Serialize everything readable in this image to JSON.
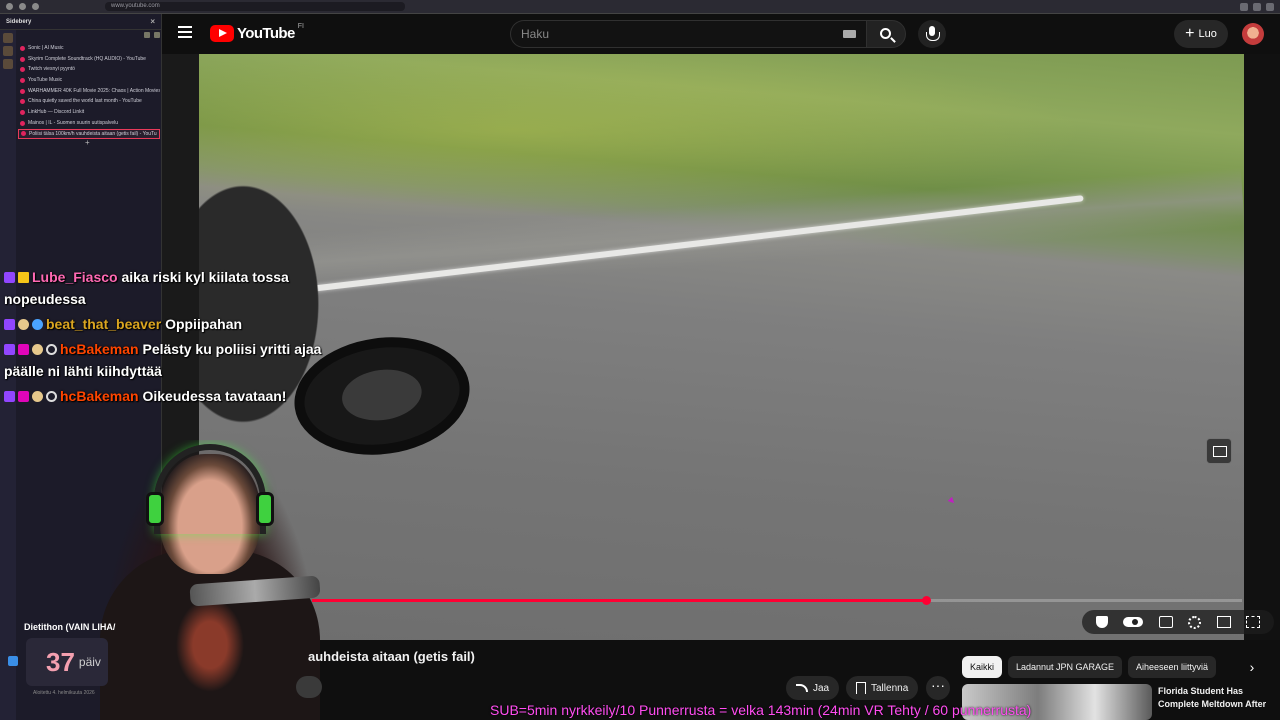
{
  "browser": {
    "url": "www.youtube.com"
  },
  "sidebery": {
    "title": "Sidebery",
    "tabs": [
      {
        "label": "Sonic | AI Music",
        "active": false
      },
      {
        "label": "Skyrim Complete Soundtrack (HQ AUDIO) - YouTube",
        "active": false
      },
      {
        "label": "Twitch viesnyi pyyntö",
        "active": false
      },
      {
        "label": "YouTube Music",
        "active": false
      },
      {
        "label": "WARHAMMER 40K Full Movie 2025: Chaos | Action Movies",
        "active": false
      },
      {
        "label": "China quietly saved the world last month - YouTube",
        "active": false
      },
      {
        "label": "LinkHub — Discord Linkit",
        "active": false
      },
      {
        "label": "Mainos | IL - Suomen suurin uutispalvelu",
        "active": false
      },
      {
        "label": "Poliisi tälsa 100km/h vauhdeista aitaan (getis fail) - YouTu",
        "active": true
      }
    ],
    "add_label": "+"
  },
  "header": {
    "logo_text": "YouTube",
    "country": "FI",
    "search_placeholder": "Haku",
    "create_label": "Luo"
  },
  "video": {
    "progress_fraction": 0.66
  },
  "chat": [
    {
      "user": "Lube_Fiasco",
      "color": "pink",
      "text": "aika riski kyl kiilata tossa nopeudessa"
    },
    {
      "user": "beat_that_beaver",
      "color": "gold",
      "text": "Oppiipahan"
    },
    {
      "user": "hcBakeman",
      "color": "red",
      "text": "Pelästy ku poliisi yritti ajaa päälle ni lähti kiihdyttää"
    },
    {
      "user": "hcBakeman",
      "color": "red",
      "text": "Oikeudessa tavataan!"
    }
  ],
  "stream": {
    "goal_title": "Dietithon (VAIN LIHA/",
    "goal_number": "37",
    "goal_unit": "päiv",
    "goal_sub": "Aloitettu 4. helmikuuta 2026",
    "ticker": "SUB=5min nyrkkeily/10 Punnerrusta = velka 143min (24min VR Tehty / 60 punnerrusta)"
  },
  "below": {
    "title_fragment": "auhdeista aitaan (getis fail)",
    "share_label": "Jaa",
    "save_label": "Tallenna",
    "more_label": "···",
    "chips": [
      "Kaikki",
      "Ladannut JPN GARAGE",
      "Aiheeseen liittyviä"
    ],
    "rec_title": "Florida Student Has Complete Meltdown After"
  }
}
